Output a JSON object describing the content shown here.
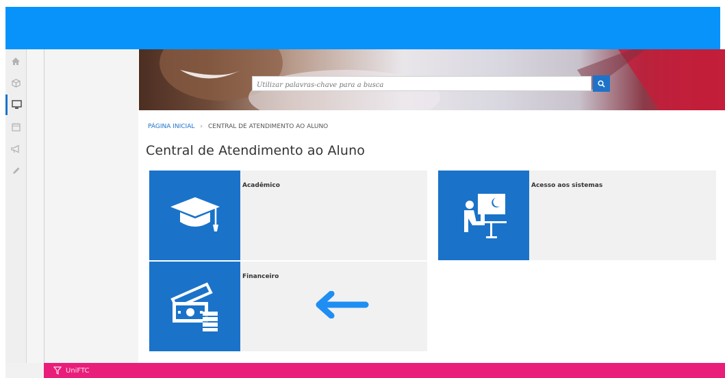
{
  "search": {
    "placeholder": "Utilizar palavras-chave para a busca"
  },
  "breadcrumb": {
    "home": "PÁGINA INICIAL",
    "separator": "›",
    "current": "CENTRAL DE ATENDIMENTO AO ALUNO"
  },
  "page": {
    "title": "Central de Atendimento ao Aluno"
  },
  "tiles": [
    {
      "label": "Acadêmico",
      "icon": "graduation-cap-icon"
    },
    {
      "label": "Acesso aos sistemas",
      "icon": "computer-desk-icon"
    },
    {
      "label": "Financeiro",
      "icon": "money-icon"
    }
  ],
  "sidebar": {
    "items": [
      {
        "icon": "home-icon"
      },
      {
        "icon": "cube-icon"
      },
      {
        "icon": "monitor-icon",
        "active": true
      },
      {
        "icon": "calendar-icon"
      },
      {
        "icon": "megaphone-icon"
      },
      {
        "icon": "pencil-icon"
      }
    ]
  },
  "footer": {
    "brand": "UniFTC"
  },
  "colors": {
    "topbar": "#0893fb",
    "accent": "#1a73c9",
    "footer": "#e91e7a",
    "tile_bg": "#f1f1f1",
    "arrow": "#1e8ef3"
  }
}
